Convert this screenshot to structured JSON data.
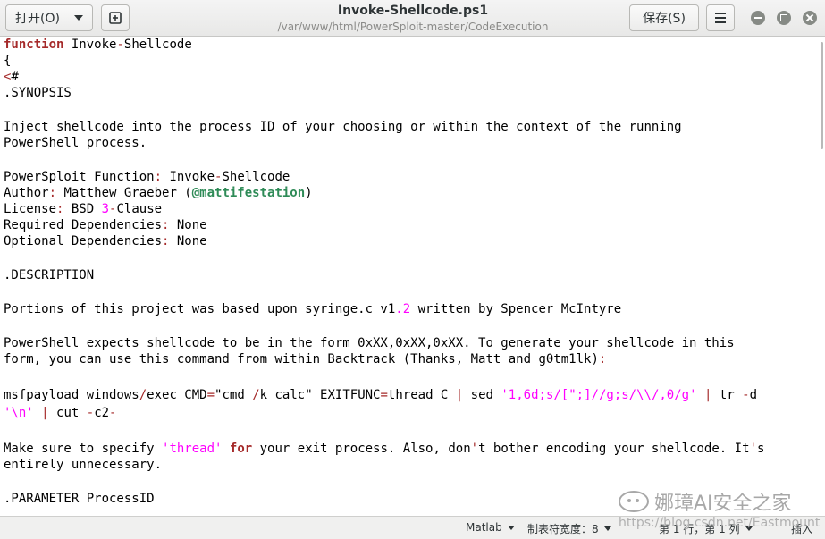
{
  "header": {
    "open_label": "打开(O)",
    "save_label": "保存(S)",
    "title": "Invoke-Shellcode.ps1",
    "path": "/var/www/html/PowerSploit-master/CodeExecution"
  },
  "code": {
    "l1_kw": "function",
    "l1_text": " Invoke",
    "l1_op": "-",
    "l1_rest": "Shellcode",
    "l2": "{",
    "l3_op": "<",
    "l3_rest": "#",
    "l4": ".SYNOPSIS",
    "l6": "Inject shellcode into the process ID of your choosing or within the context of the running",
    "l7": "PowerShell process.",
    "l9_a": "PowerSploit Function",
    "l9_op1": ":",
    "l9_b": " Invoke",
    "l9_op2": "-",
    "l9_c": "Shellcode",
    "l10_a": "Author",
    "l10_op1": ":",
    "l10_b": " Matthew Graeber (",
    "l10_at": "@mattifestation",
    "l10_c": ")",
    "l11_a": "License",
    "l11_op1": ":",
    "l11_b": " BSD ",
    "l11_num": "3",
    "l11_op2": "-",
    "l11_c": "Clause",
    "l12_a": "Required Dependencies",
    "l12_op": ":",
    "l12_b": " None",
    "l13_a": "Optional Dependencies",
    "l13_op": ":",
    "l13_b": " None",
    "l15": ".DESCRIPTION",
    "l17_a": "Portions of this project was based upon syringe.c v1",
    "l17_num": ".2",
    "l17_b": " written by Spencer McIntyre",
    "l19": "PowerShell expects shellcode to be in the form 0xXX,0xXX,0xXX. To generate your shellcode in this",
    "l20_a": "form, you can use this command from within Backtrack (Thanks, Matt and g0tm1lk)",
    "l20_op": ":",
    "l21_a": "msfpayload windows",
    "l21_op1": "/",
    "l21_b": "exec CMD",
    "l21_op2": "=",
    "l21_c": "\"cmd ",
    "l21_op3": "/",
    "l21_d": "k calc\" EXITFUNC",
    "l21_op4": "=",
    "l21_e": "thread C ",
    "l21_op5": "|",
    "l21_f": " sed ",
    "l21_str": "'1,6d;s/[\";]//g;s/\\\\/,0/g'",
    "l21_g": " ",
    "l21_op6": "|",
    "l21_h": " tr ",
    "l21_op7": "-",
    "l21_i": "d",
    "l22_str": "'\\n'",
    "l22_a": " ",
    "l22_op1": "|",
    "l22_b": " cut ",
    "l22_op2": "-",
    "l22_c": "c2",
    "l22_op3": "-",
    "l24_a": "Make sure to specify ",
    "l24_str": "'thread'",
    "l24_b": " ",
    "l24_kw": "for",
    "l24_c": " your exit process. Also, don",
    "l24_op1": "'",
    "l24_d": "t bother encoding your shellcode. It",
    "l24_op2": "'",
    "l24_e": "s",
    "l25": "entirely unnecessary.",
    "l27": ".PARAMETER ProcessID"
  },
  "status": {
    "language": "Matlab",
    "tab_width": "制表符宽度：8",
    "position": "第 1 行，第 1 列",
    "mode": "插入"
  },
  "watermark": {
    "text": "娜璋AI安全之家",
    "url": "https://blog.csdn.net/Eastmount"
  }
}
